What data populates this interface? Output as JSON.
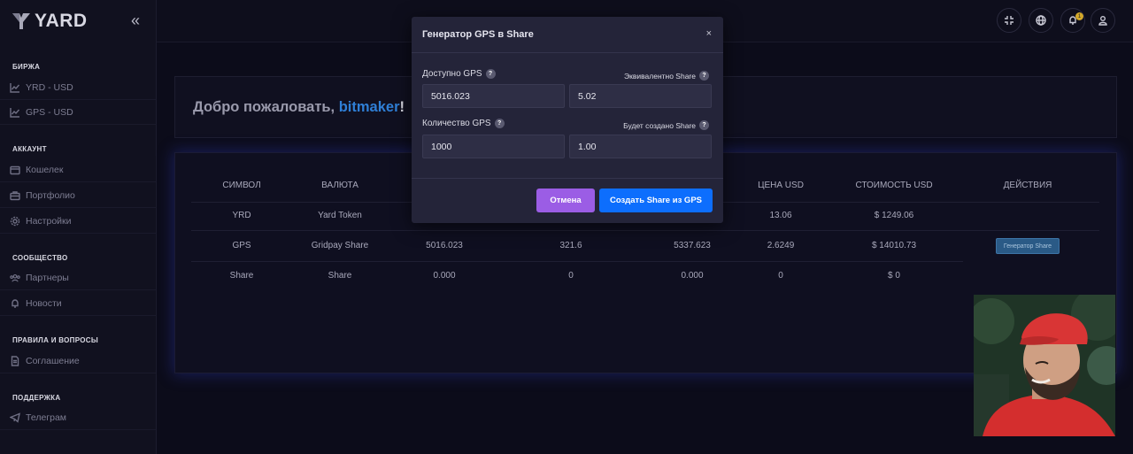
{
  "brand": {
    "name": "YARD"
  },
  "sidebar": {
    "sections": [
      {
        "title": "БИРЖА",
        "items": [
          "YRD - USD",
          "GPS - USD"
        ]
      },
      {
        "title": "АККАУНТ",
        "items": [
          "Кошелек",
          "Портфолио",
          "Настройки"
        ]
      },
      {
        "title": "СООБЩЕСТВО",
        "items": [
          "Партнеры",
          "Новости"
        ]
      },
      {
        "title": "ПРАВИЛА И ВОПРОСЫ",
        "items": [
          "Соглашение"
        ]
      },
      {
        "title": "ПОДДЕРЖКА",
        "items": [
          "Телеграм"
        ]
      }
    ]
  },
  "topbar": {
    "notification_count": "1"
  },
  "welcome": {
    "greeting": "Добро пожаловать, ",
    "username": "bitmaker",
    "suffix": "!"
  },
  "table": {
    "headers": [
      "СИМВОЛ",
      "ВАЛЮТА",
      "ЦЕНА USD",
      "СТОИМОСТЬ USD",
      "ДЕЙСТВИЯ"
    ],
    "rows": [
      {
        "symbol": "YRD",
        "currency": "Yard Token",
        "c3": "",
        "c4": "",
        "c5": "",
        "price": "13.06",
        "value": "$ 1249.06",
        "action": ""
      },
      {
        "symbol": "GPS",
        "currency": "Gridpay Share",
        "c3": "5016.023",
        "c4": "321.6",
        "c5": "5337.623",
        "price": "2.6249",
        "value": "$ 14010.73",
        "action": "Генератор Share"
      },
      {
        "symbol": "Share",
        "currency": "Share",
        "c3": "0.000",
        "c4": "0",
        "c5": "0.000",
        "price": "0",
        "value": "$ 0",
        "action": ""
      }
    ]
  },
  "modal": {
    "title": "Генератор GPS в Share",
    "close": "×",
    "available_label": "Доступно GPS",
    "available_value": "5016.023",
    "equivalent_label": "Эквивалентно Share",
    "equivalent_value": "5.02",
    "quantity_label": "Количество GPS",
    "quantity_value": "1000",
    "created_label": "Будет создано Share",
    "created_value": "1.00",
    "help": "?",
    "cancel": "Отмена",
    "submit": "Создать Share из GPS"
  },
  "colors": {
    "accent": "#0d6efd",
    "cancel": "#9b5de5",
    "username": "#2f7fd6",
    "badge": "#d3a82b"
  }
}
